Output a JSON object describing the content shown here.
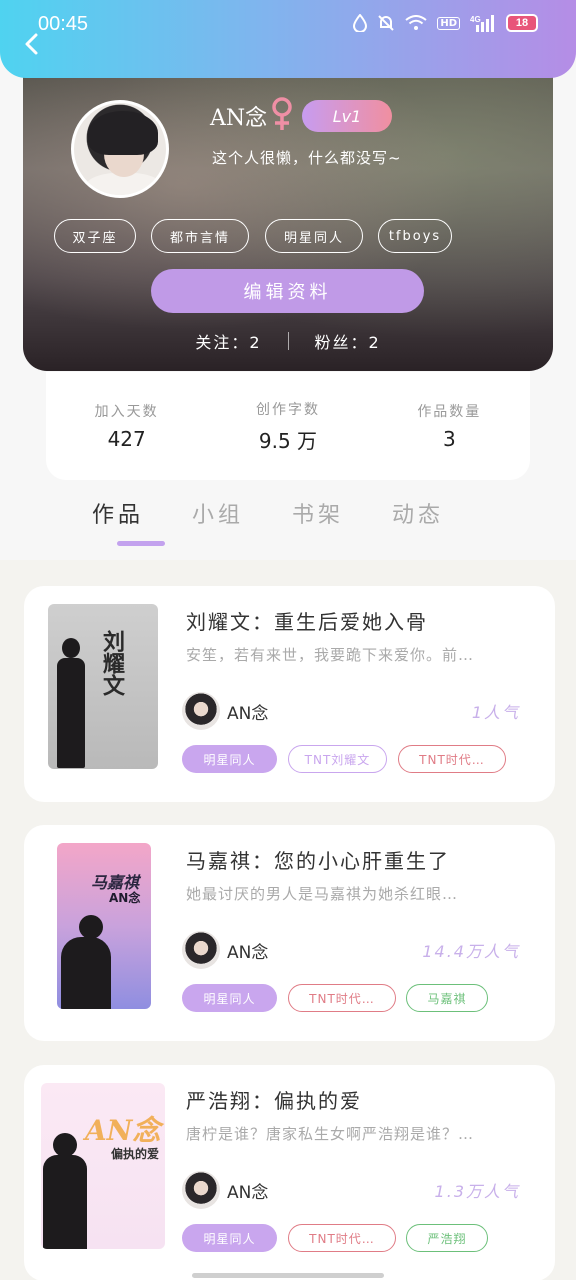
{
  "status_bar": {
    "time": "00:45",
    "signal_label": "4G",
    "hd_label": "HD",
    "battery": "18"
  },
  "profile": {
    "name": "AN念",
    "level": "Lv1",
    "bio": "这个人很懒，什么都没写~",
    "tags": [
      "双子座",
      "都市言情",
      "明星同人",
      "tfboys"
    ],
    "edit_label": "编辑资料",
    "following": "关注：2",
    "followers": "粉丝：2"
  },
  "stats": [
    {
      "label": "加入天数",
      "value": "427"
    },
    {
      "label": "创作字数",
      "value": "9.5 万"
    },
    {
      "label": "作品数量",
      "value": "3"
    }
  ],
  "tabs": [
    "作品",
    "小组",
    "书架",
    "动态"
  ],
  "active_tab": "作品",
  "works": [
    {
      "title": "刘耀文：重生后爱她入骨",
      "desc": "安笙，若有来世，我要跪下来爱你。前…",
      "author": "AN念",
      "popularity": "1人气",
      "tags": [
        "明星同人",
        "TNT刘耀文",
        "TNT时代…"
      ],
      "cover_text": "刘耀文"
    },
    {
      "title": "马嘉祺：您的小心肝重生了",
      "desc": "她最讨厌的男人是马嘉祺为她杀红眼…",
      "author": "AN念",
      "popularity": "14.4万人气",
      "tags": [
        "明星同人",
        "TNT时代…",
        "马嘉祺"
      ],
      "cover_text": "马嘉祺",
      "cover_sub": "AN念"
    },
    {
      "title": "严浩翔：偏执的爱",
      "desc": "唐柠是谁？唐家私生女啊严浩翔是谁？…",
      "author": "AN念",
      "popularity": "1.3万人气",
      "tags": [
        "明星同人",
        "TNT时代…",
        "严浩翔"
      ],
      "cover_text": "AN念",
      "cover_sub": "偏执的爱"
    }
  ],
  "colors": {
    "accent": "#c9a6ee",
    "header_start": "#4fd3f0",
    "header_end": "#b58de6",
    "tag_red": "#e07c86",
    "tag_green": "#6cc07a"
  }
}
